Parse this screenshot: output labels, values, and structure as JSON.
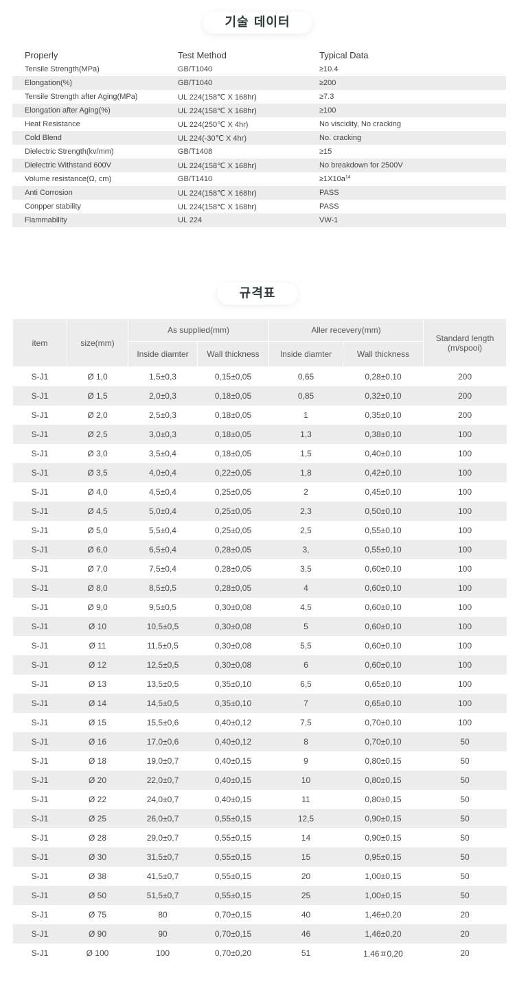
{
  "tech_title": "기술 데이터",
  "tech_headers": [
    "Properly",
    "Test Method",
    "Typical Data"
  ],
  "tech_rows": [
    [
      "Tensile Strength(MPa)",
      "GB/T1040",
      "≥10.4"
    ],
    [
      "Elongation(%)",
      "GB/T1040",
      "≥200"
    ],
    [
      "Tensile Strength after Aging(MPa)",
      "UL 224(158℃ X 168hr)",
      "≥7.3"
    ],
    [
      "Elongation after Aging(%)",
      "UL 224(158℃ X 168hr)",
      "≥100"
    ],
    [
      "Heat Resistance",
      "UL 224(250℃ X 4hr)",
      "No viscidity, No cracking"
    ],
    [
      "Cold Blend",
      "UL 224(-30℃ X 4hr)",
      "No. cracking"
    ],
    [
      "Dielectric Strength(kv/mm)",
      "GB/T1408",
      "≥15"
    ],
    [
      "Dielectric Withstand 600V",
      "UL 224(158℃ X 168hr)",
      "No breakdown for 2500V"
    ],
    [
      "Volume resistance(Ω, cm)",
      "GB/T1410",
      "≥1X10a"
    ],
    [
      "Anti Corrosion",
      "UL 224(158℃ X 168hr)",
      "PASS"
    ],
    [
      "Conpper stability",
      "UL 224(158℃ X 168hr)",
      "PASS"
    ],
    [
      "Flammability",
      "UL 224",
      "VW-1"
    ]
  ],
  "volume_exp": "14",
  "spec_title": "규격표",
  "spec_headers": {
    "item": "item",
    "size": "size(mm)",
    "as_supplied": "As supplied(mm)",
    "after_recovery": "Aller recevery(mm)",
    "standard_length": "Standard length",
    "standard_length_unit": "(m/spooi)",
    "inside_diameter_1": "Inside diamter",
    "wall_thickness_1": "Wall thickness",
    "inside_diameter_2": "Inside diamter",
    "wall_thickness_2": "Wall thickness"
  },
  "spec_rows": [
    [
      "S-J1",
      "Ø 1,0",
      "1,5±0,3",
      "0,15±0,05",
      "0,65",
      "0,28±0,10",
      "200"
    ],
    [
      "S-J1",
      "Ø 1,5",
      "2,0±0,3",
      "0,18±0,05",
      "0,85",
      "0,32±0,10",
      "200"
    ],
    [
      "S-J1",
      "Ø 2,0",
      "2,5±0,3",
      "0,18±0,05",
      "1",
      "0,35±0,10",
      "200"
    ],
    [
      "S-J1",
      "Ø 2,5",
      "3,0±0,3",
      "0,18±0,05",
      "1,3",
      "0,38±0,10",
      "100"
    ],
    [
      "S-J1",
      "Ø 3,0",
      "3,5±0,4",
      "0,18±0,05",
      "1,5",
      "0,40±0,10",
      "100"
    ],
    [
      "S-J1",
      "Ø 3,5",
      "4,0±0,4",
      "0,22±0,05",
      "1,8",
      "0,42±0,10",
      "100"
    ],
    [
      "S-J1",
      "Ø 4,0",
      "4,5±0,4",
      "0,25±0,05",
      "2",
      "0,45±0,10",
      "100"
    ],
    [
      "S-J1",
      "Ø 4,5",
      "5,0±0,4",
      "0,25±0,05",
      "2,3",
      "0,50±0,10",
      "100"
    ],
    [
      "S-J1",
      "Ø 5,0",
      "5,5±0,4",
      "0,25±0,05",
      "2,5",
      "0,55±0,10",
      "100"
    ],
    [
      "S-J1",
      "Ø 6,0",
      "6,5±0,4",
      "0,28±0,05",
      "3,",
      "0,55±0,10",
      "100"
    ],
    [
      "S-J1",
      "Ø 7,0",
      "7,5±0,4",
      "0,28±0,05",
      "3,5",
      "0,60±0,10",
      "100"
    ],
    [
      "S-J1",
      "Ø 8,0",
      "8,5±0,5",
      "0,28±0,05",
      "4",
      "0,60±0,10",
      "100"
    ],
    [
      "S-J1",
      "Ø 9,0",
      "9,5±0,5",
      "0,30±0,08",
      "4,5",
      "0,60±0,10",
      "100"
    ],
    [
      "S-J1",
      "Ø 10",
      "10,5±0,5",
      "0,30±0,08",
      "5",
      "0,60±0,10",
      "100"
    ],
    [
      "S-J1",
      "Ø 11",
      "11,5±0,5",
      "0,30±0,08",
      "5,5",
      "0,60±0,10",
      "100"
    ],
    [
      "S-J1",
      "Ø 12",
      "12,5±0,5",
      "0,30±0,08",
      "6",
      "0,60±0,10",
      "100"
    ],
    [
      "S-J1",
      "Ø 13",
      "13,5±0,5",
      "0,35±0,10",
      "6,5",
      "0,65±0,10",
      "100"
    ],
    [
      "S-J1",
      "Ø 14",
      "14,5±0,5",
      "0,35±0,10",
      "7",
      "0,65±0,10",
      "100"
    ],
    [
      "S-J1",
      "Ø 15",
      "15,5±0,6",
      "0,40±0,12",
      "7,5",
      "0,70±0,10",
      "100"
    ],
    [
      "S-J1",
      "Ø 16",
      "17,0±0,6",
      "0,40±0,12",
      "8",
      "0,70±0,10",
      "50"
    ],
    [
      "S-J1",
      "Ø 18",
      "19,0±0,7",
      "0,40±0,15",
      "9",
      "0,80±0,15",
      "50"
    ],
    [
      "S-J1",
      "Ø 20",
      "22,0±0,7",
      "0,40±0,15",
      "10",
      "0,80±0,15",
      "50"
    ],
    [
      "S-J1",
      "Ø 22",
      "24,0±0,7",
      "0,40±0,15",
      "11",
      "0,80±0,15",
      "50"
    ],
    [
      "S-J1",
      "Ø 25",
      "26,0±0,7",
      "0,55±0,15",
      "12,5",
      "0,90±0,15",
      "50"
    ],
    [
      "S-J1",
      "Ø 28",
      "29,0±0,7",
      "0,55±0,15",
      "14",
      "0,90±0,15",
      "50"
    ],
    [
      "S-J1",
      "Ø 30",
      "31,5±0,7",
      "0,55±0,15",
      "15",
      "0,95±0,15",
      "50"
    ],
    [
      "S-J1",
      "Ø 38",
      "41,5±0,7",
      "0,55±0,15",
      "20",
      "1,00±0,15",
      "50"
    ],
    [
      "S-J1",
      "Ø 50",
      "51,5±0,7",
      "0,55±0,15",
      "25",
      "1,00±0,15",
      "50"
    ],
    [
      "S-J1",
      "Ø 75",
      "80",
      "0,70±0,15",
      "40",
      "1,46±0,20",
      "20"
    ],
    [
      "S-J1",
      "Ø 90",
      "90",
      "0,70±0,15",
      "46",
      "1,46±0,20",
      "20"
    ],
    [
      "S-J1",
      "Ø 100",
      "100",
      "0,70±0,20",
      "51",
      "1,46ㅍ0,20",
      "20"
    ]
  ]
}
